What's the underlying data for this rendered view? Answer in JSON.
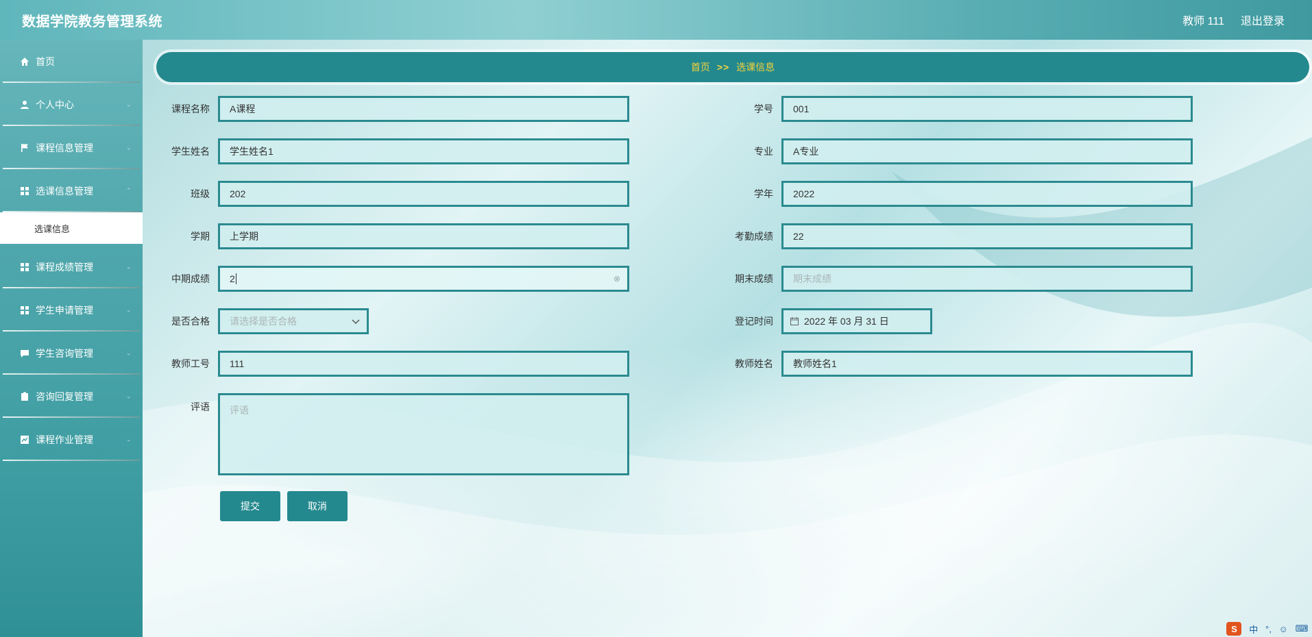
{
  "header": {
    "title": "数据学院教务管理系统",
    "user": "教师 111",
    "logout": "退出登录"
  },
  "sidebar": {
    "items": [
      {
        "label": "首页",
        "icon": "home-icon"
      },
      {
        "label": "个人中心",
        "icon": "user-icon"
      },
      {
        "label": "课程信息管理",
        "icon": "flag-icon"
      },
      {
        "label": "选课信息管理",
        "icon": "grid-icon"
      },
      {
        "label": "课程成绩管理",
        "icon": "grid-icon"
      },
      {
        "label": "学生申请管理",
        "icon": "grid-icon"
      },
      {
        "label": "学生咨询管理",
        "icon": "chat-icon"
      },
      {
        "label": "咨询回复管理",
        "icon": "clipboard-icon"
      },
      {
        "label": "课程作业管理",
        "icon": "chart-icon"
      }
    ],
    "submenu": {
      "label": "选课信息"
    }
  },
  "breadcrumb": {
    "home": "首页",
    "sep": ">>",
    "current": "选课信息"
  },
  "form": {
    "course_name": {
      "label": "课程名称",
      "value": "A课程"
    },
    "student_no": {
      "label": "学号",
      "value": "001"
    },
    "student_name": {
      "label": "学生姓名",
      "value": "学生姓名1"
    },
    "major": {
      "label": "专业",
      "value": "A专业"
    },
    "class": {
      "label": "班级",
      "value": "202"
    },
    "school_year": {
      "label": "学年",
      "value": "2022"
    },
    "term": {
      "label": "学期",
      "value": "上学期"
    },
    "attendance": {
      "label": "考勤成绩",
      "value": "22"
    },
    "midterm": {
      "label": "中期成绩",
      "value": "2"
    },
    "final": {
      "label": "期末成绩",
      "placeholder": "期末成绩"
    },
    "passed": {
      "label": "是否合格",
      "placeholder": "请选择是否合格"
    },
    "register_time": {
      "label": "登记时间",
      "value": "2022 年 03 月 31 日"
    },
    "teacher_no": {
      "label": "教师工号",
      "value": "111"
    },
    "teacher_name": {
      "label": "教师姓名",
      "value": "教师姓名1"
    },
    "comment": {
      "label": "评语",
      "placeholder": "评语"
    }
  },
  "buttons": {
    "submit": "提交",
    "cancel": "取消"
  },
  "tray": {
    "ime": "中",
    "punct": "°,"
  },
  "colors": {
    "primary": "#24898e",
    "accent": "#f4d23b"
  }
}
